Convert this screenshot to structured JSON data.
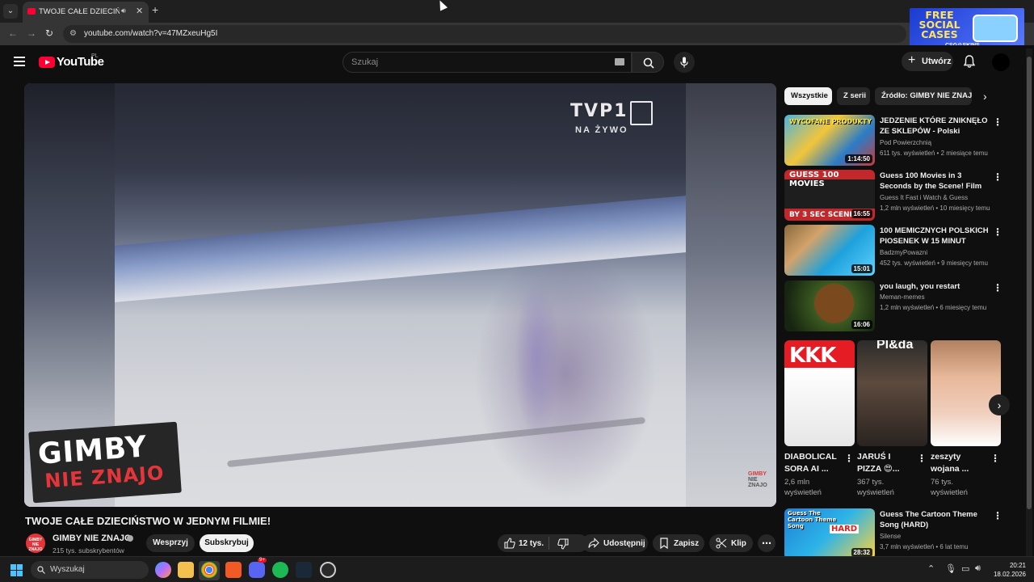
{
  "browser": {
    "tab_title": "TWOJE CAŁE DZIECIŃSTWO W JEDNYM FILMIE! - YouTube",
    "url": "youtube.com/watch?v=47MZxeuHg5I"
  },
  "ad": {
    "title": "FREE SOCIAL CASES",
    "brand": "CSG⚙SKINS"
  },
  "header": {
    "logo_text": "YouTube",
    "country": "PL",
    "search_placeholder": "Szukaj",
    "create_label": "Utwórz"
  },
  "player": {
    "tv_logo": "TVP1",
    "tv_live": "NA ŻYWO",
    "overlay_line1": "GIMBY",
    "overlay_line2": "NIE ZNAJO",
    "watermark_line1": "GIMBY",
    "watermark_line2": "NIE",
    "watermark_line3": "ZNAJO"
  },
  "video": {
    "title": "TWOJE CAŁE DZIECIŃSTWO W JEDNYM FILMIE!",
    "channel_name": "GIMBY NIE ZNAJO",
    "channel_avatar_text": "GIMBY NIE ZNAJO",
    "subscribers": "215 tys. subskrybentów",
    "join_label": "Wesprzyj",
    "subscribe_label": "Subskrybuj",
    "likes": "12 tys.",
    "share_label": "Udostępnij",
    "save_label": "Zapisz",
    "clip_label": "Klip"
  },
  "sidebar": {
    "chips": [
      "Wszystkie",
      "Z serii",
      "Źródło: GIMBY NIE ZNAJO"
    ],
    "recommendations": [
      {
        "title": "JEDZENIE KTÓRE ZNIKNĘŁO ZE SKLEPÓW - Polski Iceberg",
        "channel": "Pod Powierzchnią",
        "meta": "611 tys. wyświetleń • 2 miesiące temu",
        "duration": "1:14:50",
        "thumb_text": "WYCOFANE PRODUKTY"
      },
      {
        "title": "Guess 100 Movies in 3 Seconds by the Scene! Film Quiz ...",
        "channel": "Guess It Fast i Watch & Guess",
        "meta": "1,2 mln wyświetleń • 10 miesięcy temu",
        "duration": "16:55",
        "thumb_text_top": "GUESS 100 MOVIES",
        "thumb_text_bottom": "BY 3 SEC SCENE"
      },
      {
        "title": "100 MEMICZNYCH POLSKICH PIOSENEK W 15 MINUT",
        "channel": "BadzmyPowazni",
        "meta": "452 tys. wyświetleń • 9 miesięcy temu",
        "duration": "15:01"
      },
      {
        "title": "you laugh, you restart",
        "channel": "Meman-memes",
        "meta": "1,2 mln wyświetleń • 6 miesięcy temu",
        "duration": "16:06"
      },
      {
        "title": "Guess The Cartoon Theme Song (HARD)",
        "channel": "Silense",
        "meta": "3,7 mln wyświetleń • 6 lat temu",
        "duration": "28:32",
        "thumb_text_top": "Guess The Cartoon Theme Song",
        "thumb_text_badge": "HARD"
      }
    ],
    "shorts": [
      {
        "title": "DIABOLICAL SORA AI ...",
        "views": "2,6 mln wyświetleń",
        "thumb_text": "KKK"
      },
      {
        "title": "JARUŚ I PIZZA 😍...",
        "views": "367 tys. wyświetleń",
        "thumb_text": "Pl&da"
      },
      {
        "title": "zeszyty wojana ...",
        "views": "76 tys. wyświetleń"
      }
    ]
  },
  "taskbar": {
    "search_label": "Wyszukaj",
    "time": "20:21",
    "date": "18.02.2026",
    "discord_badge": "9+"
  }
}
